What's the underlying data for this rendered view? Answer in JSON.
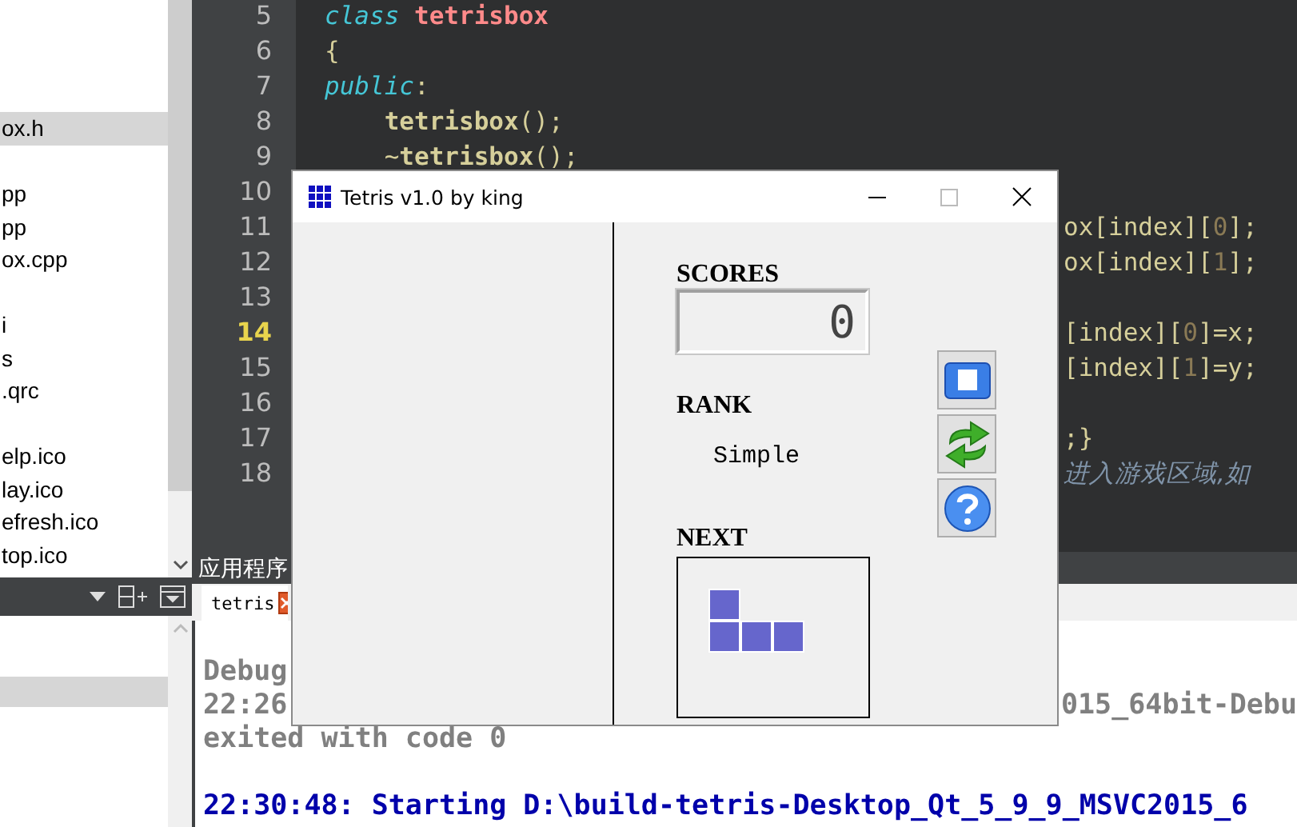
{
  "file_tree": {
    "groups": [
      {
        "items": [
          {
            "label": "ox.h",
            "selected": true
          }
        ]
      },
      {
        "items": [
          {
            "label": "pp",
            "selected": false
          },
          {
            "label": "pp",
            "selected": false
          },
          {
            "label": "ox.cpp",
            "selected": false
          }
        ]
      },
      {
        "items": [
          {
            "label": "i",
            "selected": false
          },
          {
            "label": "s",
            "selected": false
          },
          {
            "label": ".qrc",
            "selected": false
          }
        ]
      },
      {
        "items": [
          {
            "label": "elp.ico",
            "selected": false
          },
          {
            "label": "lay.ico",
            "selected": false
          },
          {
            "label": "efresh.ico",
            "selected": false
          },
          {
            "label": "top.ico",
            "selected": false
          }
        ]
      }
    ]
  },
  "lower_panel": {
    "rows": [
      {
        "selected": true
      }
    ]
  },
  "editor": {
    "lines": [
      {
        "number": "5",
        "current": false,
        "tokens": [
          {
            "text": "class",
            "kind": "keyword"
          },
          {
            "text": " tetrisbox",
            "kind": "type"
          }
        ]
      },
      {
        "number": "6",
        "current": false,
        "tokens": [
          {
            "text": "{",
            "kind": "plain"
          }
        ]
      },
      {
        "number": "7",
        "current": false,
        "tokens": [
          {
            "text": "public",
            "kind": "keyword"
          },
          {
            "text": ":",
            "kind": "plain"
          }
        ]
      },
      {
        "number": "8",
        "current": false,
        "tokens": [
          {
            "text": "    tetrisbox",
            "kind": "function"
          },
          {
            "text": "();",
            "kind": "plain"
          }
        ]
      },
      {
        "number": "9",
        "current": false,
        "tokens": [
          {
            "text": "    ~",
            "kind": "plain"
          },
          {
            "text": "tetrisbox",
            "kind": "function"
          },
          {
            "text": "();",
            "kind": "plain"
          }
        ]
      },
      {
        "number": "10",
        "current": false
      },
      {
        "number": "11",
        "current": false,
        "tail_tokens": [
          {
            "text": "ox[index][",
            "kind": "plain"
          },
          {
            "text": "0",
            "kind": "number"
          },
          {
            "text": "];",
            "kind": "plain"
          }
        ]
      },
      {
        "number": "12",
        "current": false,
        "tail_tokens": [
          {
            "text": "ox[index][",
            "kind": "plain"
          },
          {
            "text": "1",
            "kind": "number"
          },
          {
            "text": "];",
            "kind": "plain"
          }
        ]
      },
      {
        "number": "13",
        "current": false
      },
      {
        "number": "14",
        "current": true,
        "tail_tokens": [
          {
            "text": "[index][",
            "kind": "plain"
          },
          {
            "text": "0",
            "kind": "number"
          },
          {
            "text": "]=x;",
            "kind": "plain"
          }
        ]
      },
      {
        "number": "15",
        "current": false,
        "tail_tokens": [
          {
            "text": "[index][",
            "kind": "plain"
          },
          {
            "text": "1",
            "kind": "number"
          },
          {
            "text": "]=y;",
            "kind": "plain"
          }
        ]
      },
      {
        "number": "16",
        "current": false
      },
      {
        "number": "17",
        "current": false,
        "tail_tokens": [
          {
            "text": ";}",
            "kind": "plain"
          }
        ]
      },
      {
        "number": "18",
        "current": false,
        "tail_tokens": [
          {
            "text": "进入游戏区域,如",
            "kind": "comment"
          }
        ]
      }
    ]
  },
  "output_pane": {
    "title": "应用程序",
    "tabs": [
      {
        "label": "tetris",
        "selected": true
      }
    ],
    "blocks": [
      {
        "lines": [
          {
            "kind": "info",
            "text": "Debug"
          },
          {
            "kind": "info",
            "text": "22:26",
            "tail": "015_64bit-Debu"
          },
          {
            "kind": "info",
            "text": "exited with code 0"
          }
        ]
      },
      {
        "lines": [
          {
            "kind": "start",
            "text": "22:30:48: Starting D:\\build-tetris-Desktop_Qt_5_9_9_MSVC2015_6"
          }
        ]
      }
    ]
  },
  "tetris_window": {
    "title": "Tetris v1.0 by king",
    "scores": {
      "label": "SCORES",
      "value": "0"
    },
    "rank": {
      "label": "RANK",
      "value": "Simple"
    },
    "next": {
      "label": "NEXT",
      "piece": {
        "kind": "j"
      }
    },
    "buttons": [
      {
        "kind": "stop"
      },
      {
        "kind": "restart"
      },
      {
        "kind": "help"
      }
    ]
  }
}
